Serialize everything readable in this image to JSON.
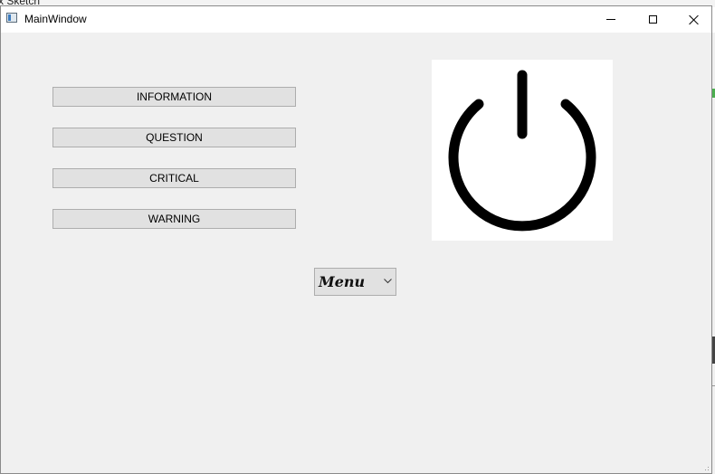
{
  "background_window": {
    "title": "x Sketch"
  },
  "window": {
    "title": "MainWindow"
  },
  "buttons": [
    {
      "label": "INFORMATION"
    },
    {
      "label": "QUESTION"
    },
    {
      "label": "CRITICAL"
    },
    {
      "label": "WARNING"
    }
  ],
  "combo": {
    "selected": "Menu"
  },
  "icons": {
    "app": "window-app-icon",
    "power": "power-icon",
    "minimize": "minimize-icon",
    "maximize": "maximize-icon",
    "close": "close-icon",
    "dropdown": "chevron-down-icon"
  },
  "colors": {
    "window_bg": "#f0f0f0",
    "button_bg": "#e1e1e1",
    "button_border": "#adadad",
    "power_icon": "#000000"
  }
}
